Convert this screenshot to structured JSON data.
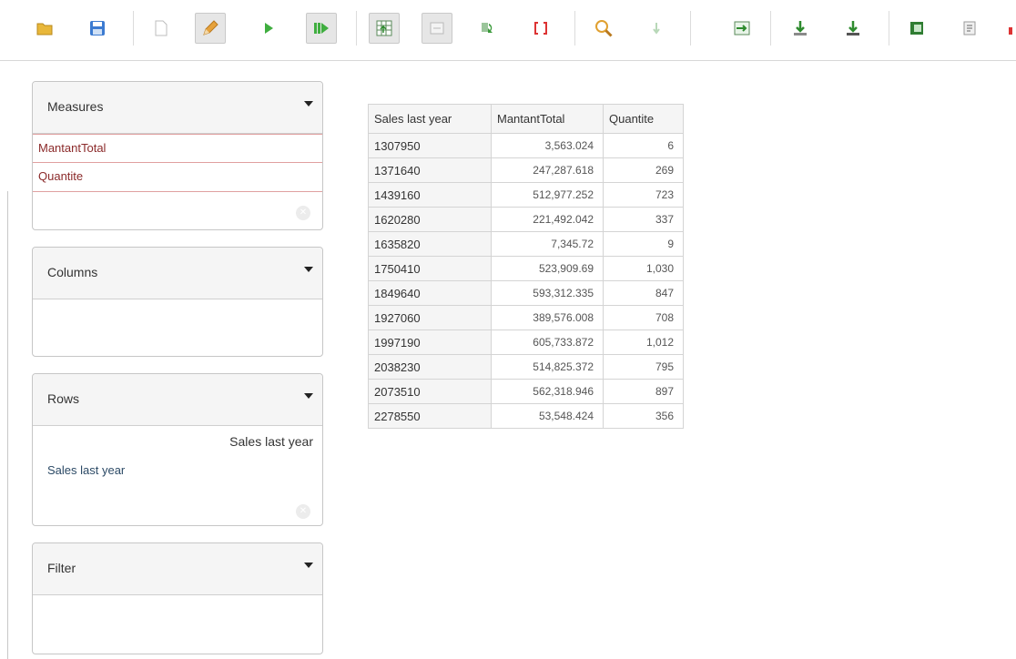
{
  "toolbar": {
    "icons": [
      "open-folder-icon",
      "save-icon",
      "new-document-icon",
      "edit-pencil-icon",
      "run-icon",
      "run-all-icon",
      "pivot-table-icon",
      "hide-spans-icon",
      "swap-axes-icon",
      "brackets-icon",
      "zoom-icon",
      "drill-down-icon",
      "drill-across-icon",
      "export-down-icon",
      "export-alt-icon",
      "excel-icon",
      "pdf-icon"
    ]
  },
  "panels": {
    "measures": {
      "title": "Measures",
      "items": [
        "MantantTotal",
        "Quantite"
      ]
    },
    "columns": {
      "title": "Columns"
    },
    "rows": {
      "title": "Rows",
      "level_label": "Sales last year",
      "member_label": "Sales last year"
    },
    "filter": {
      "title": "Filter"
    }
  },
  "table": {
    "headers": [
      "Sales last year",
      "MantantTotal",
      "Quantite"
    ],
    "rows": [
      [
        "1307950",
        "3,563.024",
        "6"
      ],
      [
        "1371640",
        "247,287.618",
        "269"
      ],
      [
        "1439160",
        "512,977.252",
        "723"
      ],
      [
        "1620280",
        "221,492.042",
        "337"
      ],
      [
        "1635820",
        "7,345.72",
        "9"
      ],
      [
        "1750410",
        "523,909.69",
        "1,030"
      ],
      [
        "1849640",
        "593,312.335",
        "847"
      ],
      [
        "1927060",
        "389,576.008",
        "708"
      ],
      [
        "1997190",
        "605,733.872",
        "1,012"
      ],
      [
        "2038230",
        "514,825.372",
        "795"
      ],
      [
        "2073510",
        "562,318.946",
        "897"
      ],
      [
        "2278550",
        "53,548.424",
        "356"
      ]
    ]
  }
}
